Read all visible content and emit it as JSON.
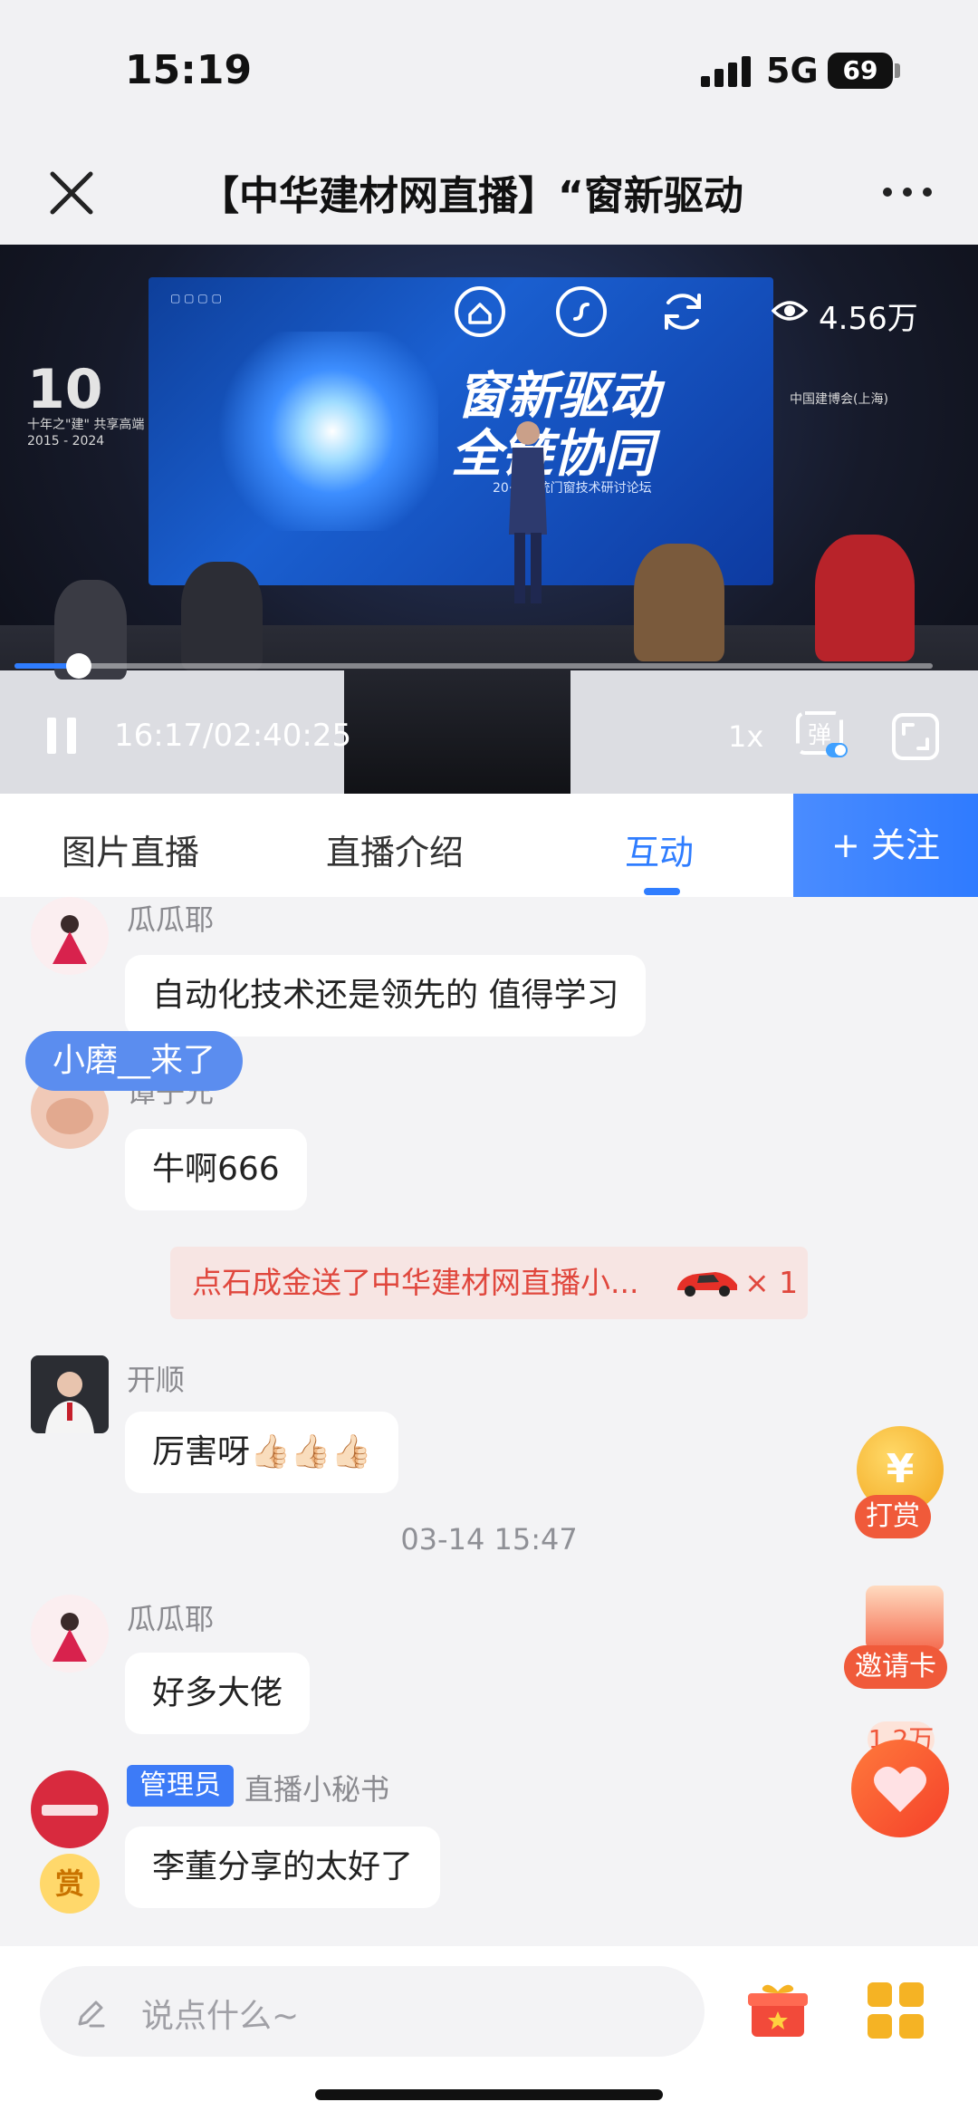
{
  "status_bar": {
    "time": "15:19",
    "network": "5G",
    "battery": "69"
  },
  "nav": {
    "title": "【中华建材网直播】“窗新驱动"
  },
  "video": {
    "viewers": "4.56万",
    "current_time": "16:17",
    "separator": "/",
    "duration": "02:40:25",
    "speed": "1x",
    "progress_fraction": 0.0035,
    "stage_title_line1": "窗新驱动",
    "stage_title_line2": "全链协同",
    "stage_subtitle": "20··· 系统门窗技术研讨论坛",
    "left_banner_big": "10",
    "left_banner_line1": "十年之\"建\" 共享高端",
    "left_banner_line2": "2015 - 2024",
    "right_banner": "中国建博会(上海)"
  },
  "tabs": {
    "items": [
      "图片直播",
      "直播介绍",
      "互动"
    ],
    "active": "互动",
    "follow": "+ 关注"
  },
  "chat": {
    "join_toast": "小磨__来了",
    "messages": [
      {
        "nick": "瓜瓜耶",
        "text": "自动化技术还是领先的 值得学习"
      },
      {
        "nick": "谭子兄",
        "text": "牛啊666"
      },
      {
        "nick": "开顺",
        "text": "厉害呀👍🏻👍🏻👍🏻"
      },
      {
        "nick": "瓜瓜耶",
        "text": "好多大佬"
      },
      {
        "nick": "直播小秘书",
        "text": "李董分享的太好了",
        "badge": "管理员"
      }
    ],
    "gift_notice": {
      "text": "点石成金送了中华建材网直播小...",
      "count": "× 1"
    },
    "timestamp": "03-14 15:47",
    "reward_badge": "赏"
  },
  "side_buttons": {
    "tip_label": "打赏",
    "tip_symbol": "¥",
    "invite_label": "邀请卡",
    "like_count": "1.2万"
  },
  "input": {
    "placeholder": "说点什么~"
  },
  "colors": {
    "accent": "#2f7dff",
    "danger": "#f05a3a",
    "gold": "#f5b324"
  }
}
